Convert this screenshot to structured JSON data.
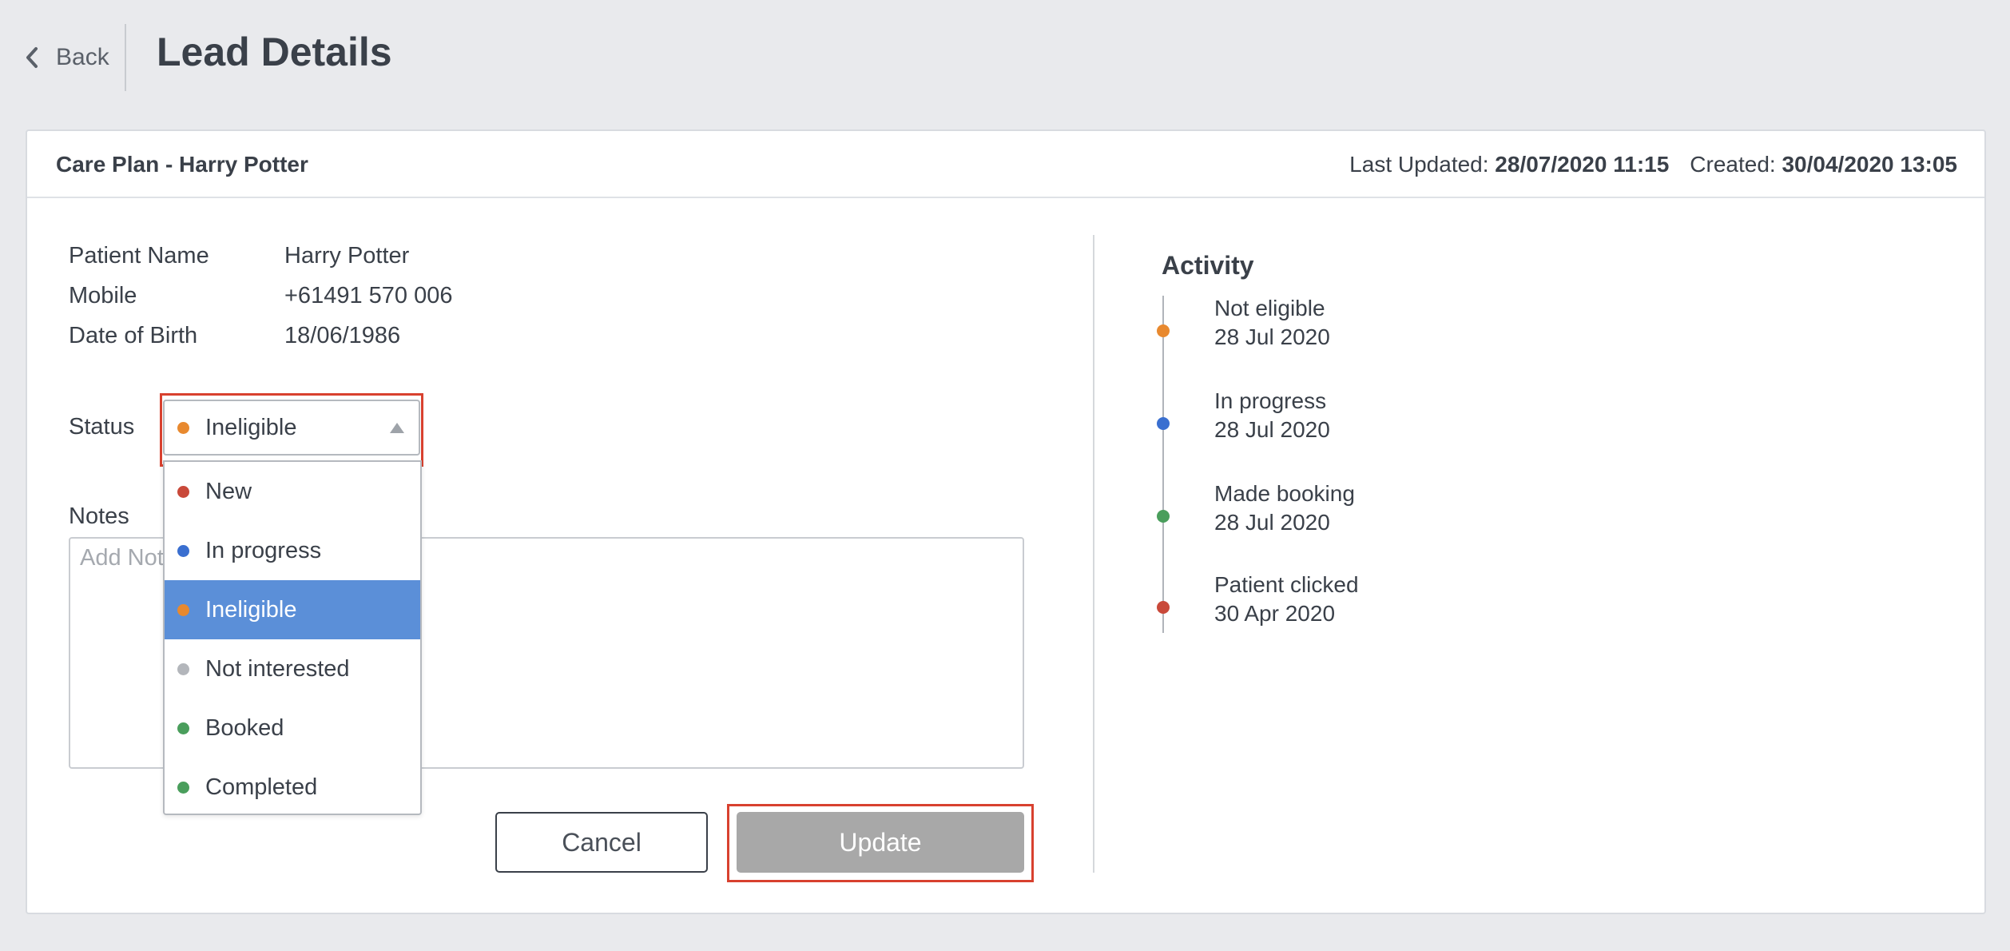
{
  "header": {
    "back_label": "Back",
    "title": "Lead Details"
  },
  "card": {
    "title": "Care Plan - Harry Potter",
    "last_updated_label": "Last Updated:",
    "last_updated_value": "28/07/2020 11:15",
    "created_label": "Created:",
    "created_value": "30/04/2020 13:05"
  },
  "patient": {
    "name_label": "Patient Name",
    "name_value": "Harry Potter",
    "mobile_label": "Mobile",
    "mobile_value": "+61491 570 006",
    "dob_label": "Date of Birth",
    "dob_value": "18/06/1986"
  },
  "status": {
    "label": "Status",
    "selected": "Ineligible",
    "selected_color": "#e8892f",
    "options": [
      {
        "label": "New",
        "color": "#c9493a",
        "selected": false
      },
      {
        "label": "In progress",
        "color": "#3a6fd0",
        "selected": false
      },
      {
        "label": "Ineligible",
        "color": "#e8892f",
        "selected": true
      },
      {
        "label": "Not interested",
        "color": "#b3b6bb",
        "selected": false
      },
      {
        "label": "Booked",
        "color": "#4a9e5c",
        "selected": false
      },
      {
        "label": "Completed",
        "color": "#4a9e5c",
        "selected": false
      }
    ]
  },
  "notes": {
    "label": "Notes",
    "placeholder": "Add Notes",
    "value": ""
  },
  "buttons": {
    "cancel": "Cancel",
    "update": "Update"
  },
  "activity": {
    "title": "Activity",
    "items": [
      {
        "title": "Not eligible",
        "date": "28 Jul 2020",
        "color": "#e8892f"
      },
      {
        "title": "In progress",
        "date": "28 Jul 2020",
        "color": "#3a6fd0"
      },
      {
        "title": "Made booking",
        "date": "28 Jul 2020",
        "color": "#4a9e5c"
      },
      {
        "title": "Patient clicked",
        "date": "30 Apr 2020",
        "color": "#c9493a"
      }
    ]
  },
  "colors": {
    "highlight": "#d8412f",
    "selected_option_bg": "#5b8fd8",
    "update_button_bg": "#a8a8a8"
  }
}
